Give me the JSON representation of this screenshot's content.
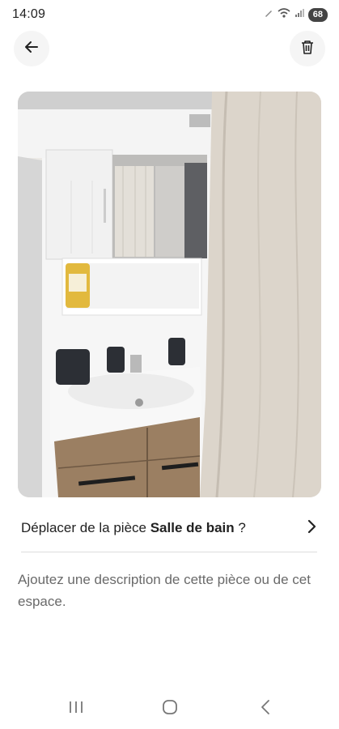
{
  "status_bar": {
    "time": "14:09",
    "battery": "68",
    "icons": [
      "pen-icon",
      "wifi-icon",
      "signal-icon",
      "battery-icon"
    ]
  },
  "header": {
    "back_icon": "arrow-left-icon",
    "delete_icon": "trash-icon"
  },
  "photo": {
    "subject": "bathroom-vanity-photo"
  },
  "room": {
    "prefix": "Déplacer de la pièce ",
    "name": "Salle de bain",
    "suffix": " ?",
    "chevron_icon": "chevron-right-icon"
  },
  "description": {
    "placeholder": "Ajoutez une description de cette pièce ou de cet espace."
  },
  "nav_bar": {
    "icons": [
      "recent-apps-icon",
      "home-icon",
      "back-icon"
    ]
  },
  "colors": {
    "text": "#222222",
    "muted": "#6a6a6a",
    "button_bg": "#f5f5f5",
    "divider": "#dddddd"
  }
}
